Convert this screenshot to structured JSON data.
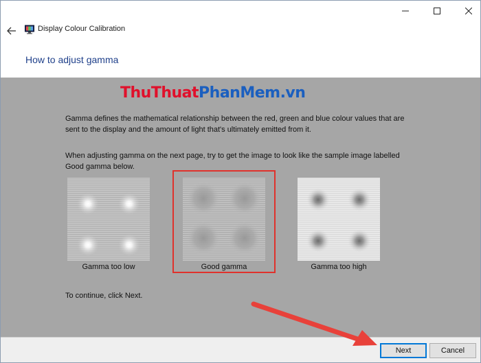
{
  "window": {
    "title": "Display Colour Calibration",
    "controls": {
      "minimize": "minimize-icon",
      "maximize": "maximize-icon",
      "close": "close-icon"
    }
  },
  "page": {
    "title": "How to adjust gamma"
  },
  "watermark": {
    "part_a": "ThuThuat",
    "part_b": "PhanMem.vn"
  },
  "content": {
    "paragraph1": "Gamma defines the mathematical relationship between the red, green and blue colour values that are sent to the display and the amount of light that's ultimately emitted from it.",
    "paragraph2": "When adjusting gamma on the next page, try to get the image to look like the sample image labelled Good gamma below.",
    "samples": [
      {
        "label": "Gamma too low"
      },
      {
        "label": "Good gamma"
      },
      {
        "label": "Gamma too high"
      }
    ],
    "continue_text": "To continue, click Next."
  },
  "buttons": {
    "next": "Next",
    "cancel": "Cancel"
  },
  "colors": {
    "content_bg": "#a6a6a6",
    "title_blue": "#1e3f8a",
    "highlight_red": "#e0312b",
    "annotation_arrow": "#e8413a",
    "primary_border": "#0078d7"
  }
}
